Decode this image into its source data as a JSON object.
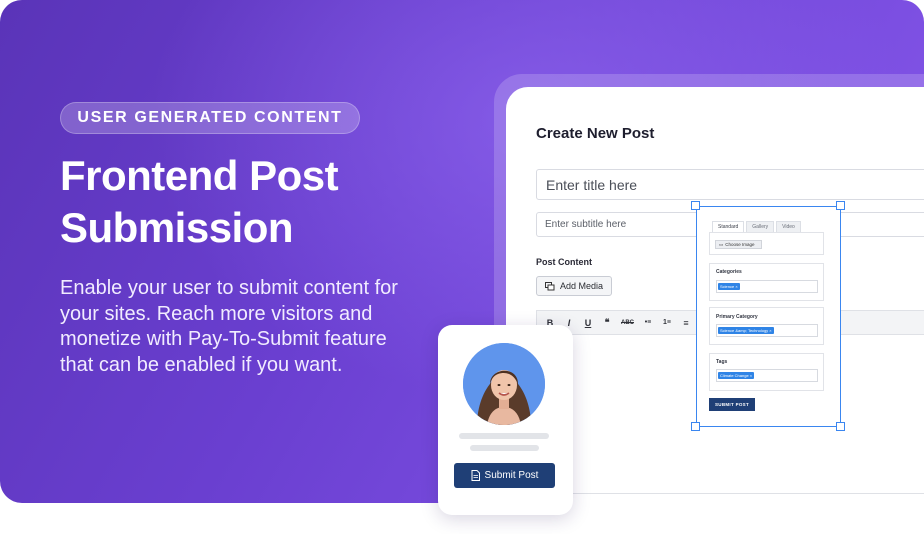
{
  "hero": {
    "tag": "USER GENERATED CONTENT",
    "headline_line1": "Frontend Post",
    "headline_line2": "Submission",
    "description": "Enable your user to submit content for your sites. Reach more visitors and monetize with Pay-To-Submit feature that can be enabled if you want."
  },
  "editor": {
    "title": "Create New Post",
    "title_placeholder": "Enter title here",
    "subtitle_placeholder": "Enter subtitle here",
    "content_label": "Post Content",
    "add_media_label": "Add Media",
    "toolbar": [
      "B",
      "I",
      "U",
      "❝",
      "ABC",
      "•≡",
      "1≡",
      "≡"
    ]
  },
  "widget": {
    "tabs": [
      "Standard",
      "Gallery",
      "Video"
    ],
    "choose_image": "Choose Image",
    "categories_label": "Categories",
    "categories_chip": "Science ×",
    "primary_category_label": "Primary Category",
    "primary_category_chip": "Science &amp; Technology ×",
    "tags_label": "Tags",
    "tags_chip": "Climate Change ×",
    "submit_label": "SUBMIT POST"
  },
  "profile_card": {
    "submit_label": "Submit Post"
  },
  "colors": {
    "background_start": "#5a34b8",
    "background_end": "#8a5ceb",
    "button_navy": "#1f3f76",
    "selection_blue": "#3a86f0"
  }
}
